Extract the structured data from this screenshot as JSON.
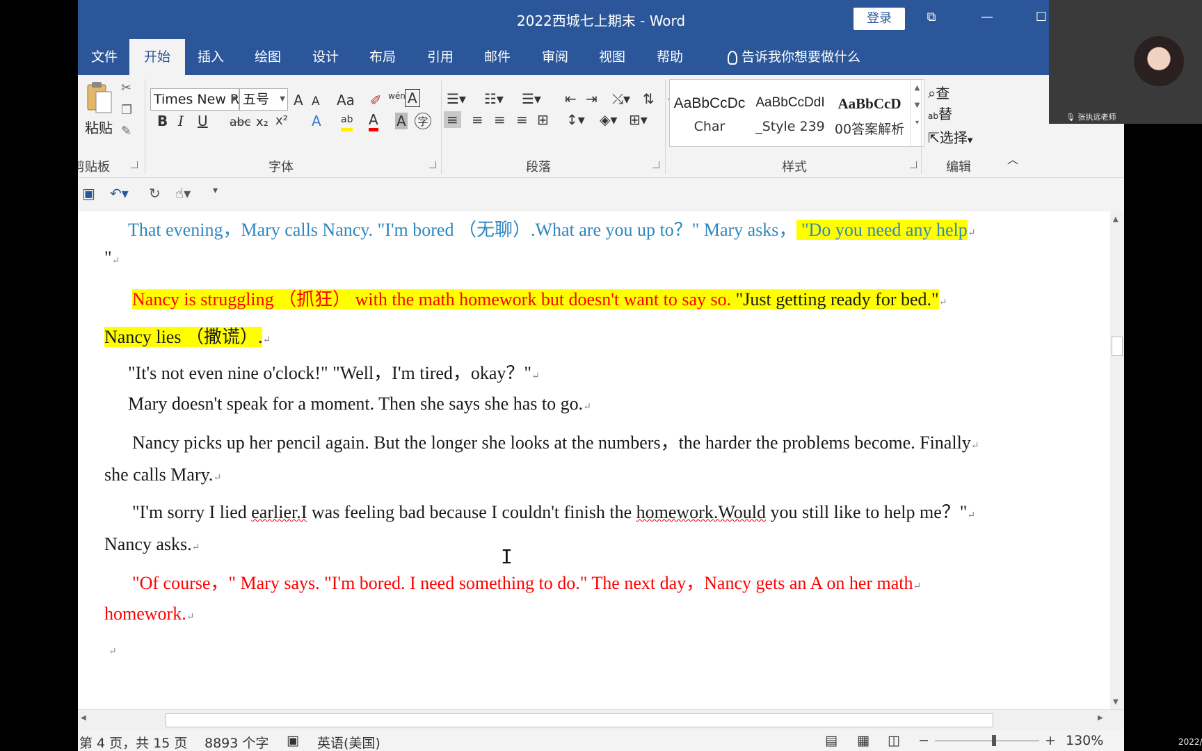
{
  "window": {
    "title": "2022西城七上期末  -  Word",
    "signin": "登录",
    "controls": [
      "⧉",
      "—",
      "☐"
    ]
  },
  "tabs": [
    {
      "label": "文件"
    },
    {
      "label": "开始"
    },
    {
      "label": "插入"
    },
    {
      "label": "绘图"
    },
    {
      "label": "设计"
    },
    {
      "label": "布局"
    },
    {
      "label": "引用"
    },
    {
      "label": "邮件"
    },
    {
      "label": "审阅"
    },
    {
      "label": "视图"
    },
    {
      "label": "帮助"
    },
    {
      "label": "告诉我你想要做什么"
    }
  ],
  "ribbon": {
    "clipboard": {
      "paste": "粘贴",
      "label": "剪贴板"
    },
    "font": {
      "family": "Times New R",
      "size": "五号",
      "grow": "A",
      "shrink": "A",
      "change_case": "Aa",
      "phonetic": "wén",
      "bold": "B",
      "italic": "I",
      "underline": "U",
      "strike": "abc",
      "subscript": "x₂",
      "superscript": "x²",
      "effects": "A",
      "highlight": "ab",
      "font_color": "A",
      "char_shade": "A",
      "enclose": "字",
      "label": "字体"
    },
    "paragraph": {
      "label": "段落"
    },
    "styles": {
      "items": [
        {
          "sample": "AaBbCcDc",
          "name": "Char"
        },
        {
          "sample": "AaBbCcDdI",
          "name": "_Style 239"
        },
        {
          "sample": "AaBbCcD",
          "name": "00答案解析"
        }
      ],
      "label": "样式"
    },
    "editing": {
      "find": "查",
      "replace": "替",
      "select": "选择",
      "label": "编辑"
    }
  },
  "document": {
    "lines": [
      {
        "segments": [
          {
            "text": "That evening，Mary calls Nancy. \"I'm bored （无聊）.What are you up to？\" Mary asks，",
            "color": "blue"
          },
          {
            "text": " \"Do you need any help",
            "color": "blue",
            "hl": true
          }
        ]
      },
      {
        "segments": [
          {
            "text": "\"",
            "color": "black"
          }
        ]
      },
      {
        "segments": [
          {
            "text": "Nancy is struggling （抓狂） with the math homework but doesn't want to say so.",
            "color": "red",
            "hl": true
          },
          {
            "text": " \"Just getting ready for bed.\"",
            "color": "black",
            "hl": true
          }
        ]
      },
      {
        "segments": [
          {
            "text": "Nancy lies （撒谎）.",
            "color": "black",
            "hl": true
          }
        ]
      },
      {
        "segments": [
          {
            "text": "\"It's not even nine o'clock!\" \"Well，I'm tired，okay？\"",
            "color": "black"
          }
        ]
      },
      {
        "segments": [
          {
            "text": "Mary doesn't speak for a moment. Then she says she has to go.",
            "color": "black"
          }
        ]
      },
      {
        "segments": [
          {
            "text": "Nancy picks up her pencil again. But the longer she looks at the numbers，the harder the problems become. Finally",
            "color": "black"
          }
        ]
      },
      {
        "segments": [
          {
            "text": "she calls Mary.",
            "color": "black"
          }
        ]
      },
      {
        "segments": [
          {
            "text": "\"I'm sorry I lied ",
            "color": "black"
          },
          {
            "text": "earlier.I",
            "color": "black",
            "squig": true
          },
          {
            "text": " was feeling bad because I couldn't finish the ",
            "color": "black"
          },
          {
            "text": "homework.Would",
            "color": "black",
            "squig": true
          },
          {
            "text": " you still like to help me？\"",
            "color": "black"
          }
        ]
      },
      {
        "segments": [
          {
            "text": "Nancy asks.",
            "color": "black"
          }
        ]
      },
      {
        "segments": [
          {
            "text": "\"Of course，\" Mary says. \"I'm bored. I need something to do.\" The next day，Nancy gets an A on her math",
            "color": "red"
          }
        ]
      },
      {
        "segments": [
          {
            "text": "homework.",
            "color": "red"
          }
        ]
      },
      {
        "segments": [
          {
            "text": "",
            "color": "black"
          }
        ]
      }
    ],
    "para_mark": "↵",
    "cursor": "I"
  },
  "status": {
    "page": "第 4 页，共 15 页",
    "words": "8893 个字",
    "language": "英语(美国)",
    "zoom": "130%",
    "zoom_minus": "−",
    "zoom_plus": "+"
  },
  "overlay": {
    "presenter": "张执远老师",
    "corner_date": "2022/"
  },
  "colors": {
    "word_blue": "#2b579a",
    "doc_blue": "#2e86c1",
    "doc_red": "#ff0000",
    "highlight": "#ffff00"
  }
}
